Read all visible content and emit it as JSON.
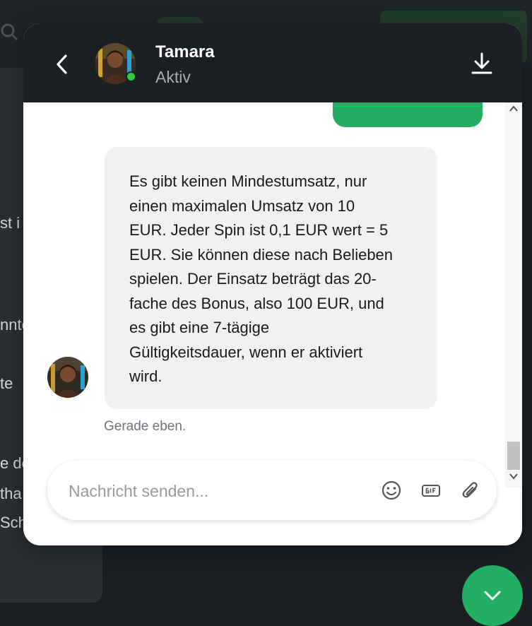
{
  "background": {
    "fragments": [
      "st i",
      "nnte",
      "te",
      "e de",
      "tha",
      "Sch"
    ]
  },
  "header": {
    "agent_name": "Tamara",
    "agent_status": "Aktiv",
    "icons": {
      "back": "chevron-left-icon",
      "download": "download-icon"
    }
  },
  "conversation": {
    "messages": [
      {
        "sender": "agent",
        "text": "Es gibt keinen Mindestumsatz, nur\neinen maximalen Umsatz von 10\nEUR. Jeder Spin ist 0,1 EUR wert = 5\nEUR. Sie können diese nach Belieben\nspielen. Der Einsatz beträgt das 20-\nfache des Bonus, also 100 EUR, und\nes gibt eine 7-tägige\nGültigkeitsdauer, wenn er aktiviert\nwird.",
        "timestamp": "Gerade eben."
      }
    ]
  },
  "composer": {
    "placeholder": "Nachricht senden...",
    "icons": [
      "emoji-icon",
      "gif-icon",
      "paperclip-icon"
    ]
  },
  "colors": {
    "accent": "#22ae63",
    "header_bg": "#1c2024",
    "bubble_bg": "#f1f1f1",
    "online": "#2ecc40"
  }
}
